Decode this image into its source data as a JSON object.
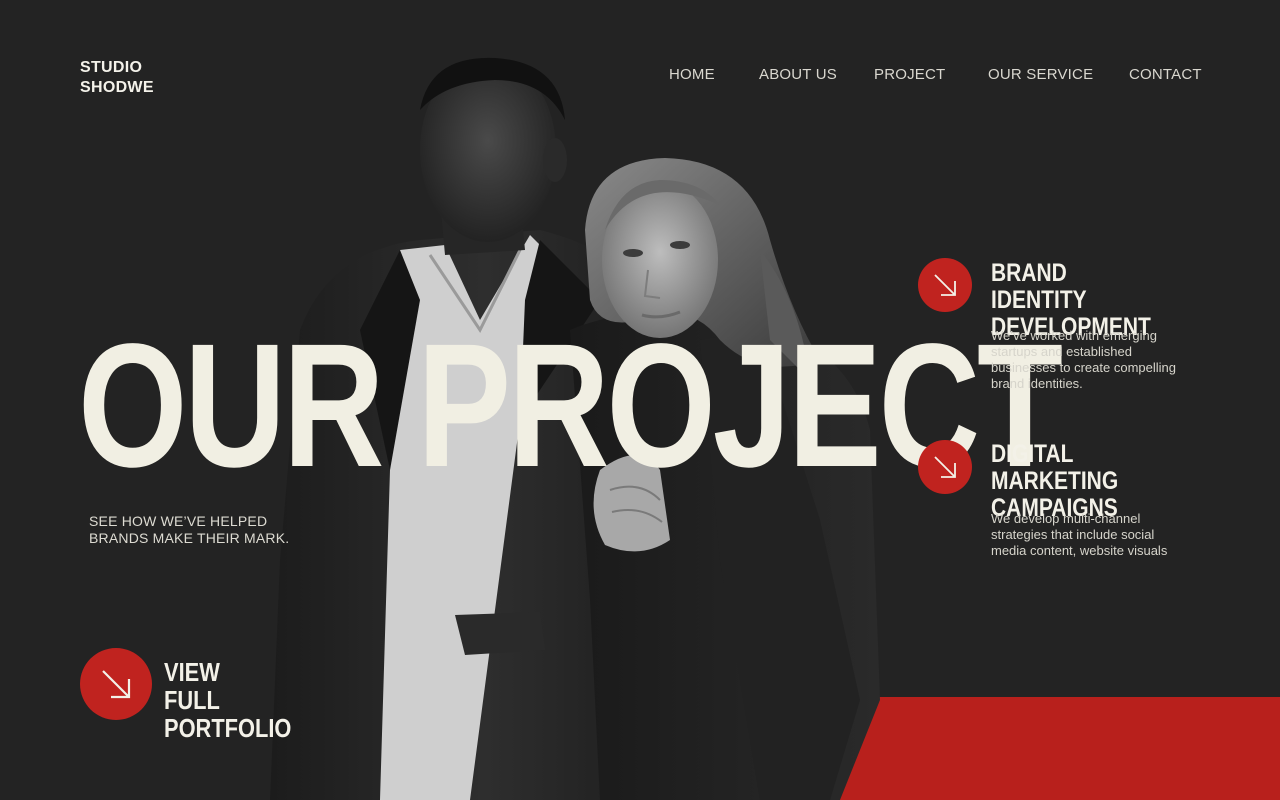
{
  "brand": {
    "line1": "STUDIO",
    "line2": "SHODWE"
  },
  "nav": {
    "items": [
      {
        "label": "HOME"
      },
      {
        "label": "ABOUT US"
      },
      {
        "label": "PROJECT"
      },
      {
        "label": "OUR SERVICE"
      },
      {
        "label": "CONTACT"
      }
    ]
  },
  "hero": {
    "title": "OUR PROJECT",
    "subtitle_line1": "SEE HOW WE’VE HELPED",
    "subtitle_line2": "BRANDS MAKE THEIR MARK."
  },
  "cta": {
    "line1": "VIEW FULL",
    "line2": "PORTFOLIO",
    "icon": "arrow-down-right-icon"
  },
  "services": [
    {
      "title_line1": "BRAND IDENTITY",
      "title_line2": "DEVELOPMENT",
      "description": "We’ve worked with emerging startups and established businesses to create compelling brand identities.",
      "icon": "arrow-down-right-icon"
    },
    {
      "title_line1": "DIGITAL MARKETING",
      "title_line2": "CAMPAIGNS",
      "description": "We develop multi-channel strategies that include social media content, website visuals",
      "icon": "arrow-down-right-icon"
    }
  ],
  "colors": {
    "background": "#232323",
    "accent": "#c0231f",
    "text": "#f2f0e6"
  }
}
